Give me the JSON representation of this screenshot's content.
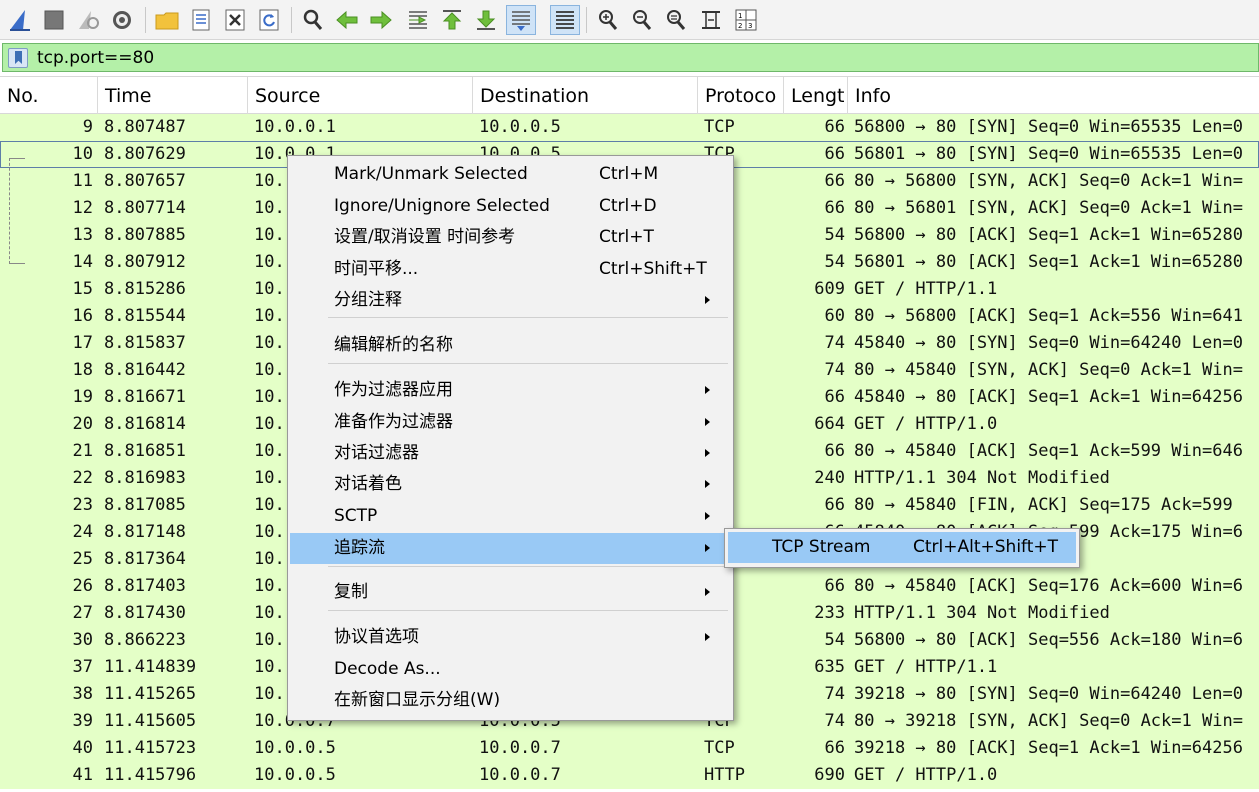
{
  "filter": {
    "text": "tcp.port==80"
  },
  "columns": {
    "no": "No.",
    "time": "Time",
    "source": "Source",
    "destination": "Destination",
    "protocol": "Protoco",
    "length": "Lengt",
    "info": "Info"
  },
  "packets": [
    {
      "no": "9",
      "time": "8.807487",
      "src": "10.0.0.1",
      "dst": "10.0.0.5",
      "proto": "TCP",
      "len": "66",
      "info": "56800 → 80 [SYN] Seq=0 Win=65535 Len=0"
    },
    {
      "no": "10",
      "time": "8.807629",
      "src": "10.0.0.1",
      "dst": "10.0.0.5",
      "proto": "TCP",
      "len": "66",
      "info": "56801 → 80 [SYN] Seq=0 Win=65535 Len=0"
    },
    {
      "no": "11",
      "time": "8.807657",
      "src": "10.",
      "dst": "",
      "proto": "",
      "len": "66",
      "info": "80 → 56800 [SYN, ACK] Seq=0 Ack=1 Win="
    },
    {
      "no": "12",
      "time": "8.807714",
      "src": "10.",
      "dst": "",
      "proto": "",
      "len": "66",
      "info": "80 → 56801 [SYN, ACK] Seq=0 Ack=1 Win="
    },
    {
      "no": "13",
      "time": "8.807885",
      "src": "10.",
      "dst": "",
      "proto": "",
      "len": "54",
      "info": "56800 → 80 [ACK] Seq=1 Ack=1 Win=65280"
    },
    {
      "no": "14",
      "time": "8.807912",
      "src": "10.",
      "dst": "",
      "proto": "",
      "len": "54",
      "info": "56801 → 80 [ACK] Seq=1 Ack=1 Win=65280"
    },
    {
      "no": "15",
      "time": "8.815286",
      "src": "10.",
      "dst": "",
      "proto": "P",
      "len": "609",
      "info": "GET / HTTP/1.1"
    },
    {
      "no": "16",
      "time": "8.815544",
      "src": "10.",
      "dst": "",
      "proto": "",
      "len": "60",
      "info": "80 → 56800 [ACK] Seq=1 Ack=556 Win=641"
    },
    {
      "no": "17",
      "time": "8.815837",
      "src": "10.",
      "dst": "",
      "proto": "",
      "len": "74",
      "info": "45840 → 80 [SYN] Seq=0 Win=64240 Len=0"
    },
    {
      "no": "18",
      "time": "8.816442",
      "src": "10.",
      "dst": "",
      "proto": "",
      "len": "74",
      "info": "80 → 45840 [SYN, ACK] Seq=0 Ack=1 Win="
    },
    {
      "no": "19",
      "time": "8.816671",
      "src": "10.",
      "dst": "",
      "proto": "",
      "len": "66",
      "info": "45840 → 80 [ACK] Seq=1 Ack=1 Win=64256"
    },
    {
      "no": "20",
      "time": "8.816814",
      "src": "10.",
      "dst": "",
      "proto": "P",
      "len": "664",
      "info": "GET / HTTP/1.0"
    },
    {
      "no": "21",
      "time": "8.816851",
      "src": "10.",
      "dst": "",
      "proto": "",
      "len": "66",
      "info": "80 → 45840 [ACK] Seq=1 Ack=599 Win=646"
    },
    {
      "no": "22",
      "time": "8.816983",
      "src": "10.",
      "dst": "",
      "proto": "P",
      "len": "240",
      "info": "HTTP/1.1 304 Not Modified"
    },
    {
      "no": "23",
      "time": "8.817085",
      "src": "10.",
      "dst": "",
      "proto": "",
      "len": "66",
      "info": "80 → 45840 [FIN, ACK] Seq=175 Ack=599"
    },
    {
      "no": "24",
      "time": "8.817148",
      "src": "10.",
      "dst": "",
      "proto": "",
      "len": "66",
      "info": "45840 → 80 [ACK] Seq=599 Ack=175 Win=6"
    },
    {
      "no": "25",
      "time": "8.817364",
      "src": "10.",
      "dst": "",
      "proto": "",
      "len": "",
      "info": "Seq=599 Ack=176"
    },
    {
      "no": "26",
      "time": "8.817403",
      "src": "10.",
      "dst": "",
      "proto": "",
      "len": "66",
      "info": "80 → 45840 [ACK] Seq=176 Ack=600 Win=6"
    },
    {
      "no": "27",
      "time": "8.817430",
      "src": "10.",
      "dst": "",
      "proto": "P",
      "len": "233",
      "info": "HTTP/1.1 304 Not Modified"
    },
    {
      "no": "30",
      "time": "8.866223",
      "src": "10.",
      "dst": "",
      "proto": "",
      "len": "54",
      "info": "56800 → 80 [ACK] Seq=556 Ack=180 Win=6"
    },
    {
      "no": "37",
      "time": "11.414839",
      "src": "10.",
      "dst": "",
      "proto": "P",
      "len": "635",
      "info": "GET / HTTP/1.1"
    },
    {
      "no": "38",
      "time": "11.415265",
      "src": "10.",
      "dst": "",
      "proto": "",
      "len": "74",
      "info": "39218 → 80 [SYN] Seq=0 Win=64240 Len=0"
    },
    {
      "no": "39",
      "time": "11.415605",
      "src": "10.0.0.7",
      "dst": "10.0.0.5",
      "proto": "TCP",
      "len": "74",
      "info": "80 → 39218 [SYN, ACK] Seq=0 Ack=1 Win="
    },
    {
      "no": "40",
      "time": "11.415723",
      "src": "10.0.0.5",
      "dst": "10.0.0.7",
      "proto": "TCP",
      "len": "66",
      "info": "39218 → 80 [ACK] Seq=1 Ack=1 Win=64256"
    },
    {
      "no": "41",
      "time": "11.415796",
      "src": "10.0.0.5",
      "dst": "10.0.0.7",
      "proto": "HTTP",
      "len": "690",
      "info": "GET / HTTP/1.0"
    }
  ],
  "context_menu": {
    "items": [
      {
        "label": "Mark/Unmark Selected",
        "shortcut": "Ctrl+M",
        "submenu": false
      },
      {
        "label": "Ignore/Unignore Selected",
        "shortcut": "Ctrl+D",
        "submenu": false
      },
      {
        "label": "设置/取消设置 时间参考",
        "shortcut": "Ctrl+T",
        "submenu": false
      },
      {
        "label": "时间平移...",
        "shortcut": "Ctrl+Shift+T",
        "submenu": false
      },
      {
        "label": "分组注释",
        "shortcut": "",
        "submenu": true
      },
      {
        "label": "编辑解析的名称",
        "shortcut": "",
        "submenu": false
      },
      {
        "label": "作为过滤器应用",
        "shortcut": "",
        "submenu": true
      },
      {
        "label": "准备作为过滤器",
        "shortcut": "",
        "submenu": true
      },
      {
        "label": "对话过滤器",
        "shortcut": "",
        "submenu": true
      },
      {
        "label": "对话着色",
        "shortcut": "",
        "submenu": true
      },
      {
        "label": "SCTP",
        "shortcut": "",
        "submenu": true
      },
      {
        "label": "追踪流",
        "shortcut": "",
        "submenu": true,
        "highlighted": true
      },
      {
        "label": "复制",
        "shortcut": "",
        "submenu": true
      },
      {
        "label": "协议首选项",
        "shortcut": "",
        "submenu": true
      },
      {
        "label": "Decode As...",
        "shortcut": "",
        "submenu": false
      },
      {
        "label": "在新窗口显示分组(W)",
        "shortcut": "",
        "submenu": false
      }
    ]
  },
  "submenu": {
    "label": "TCP Stream",
    "shortcut": "Ctrl+Alt+Shift+T"
  },
  "colors": {
    "row_bg": "#e4ffc7",
    "filter_bg": "#b4f0a8",
    "menu_highlight": "#99c9f5"
  }
}
